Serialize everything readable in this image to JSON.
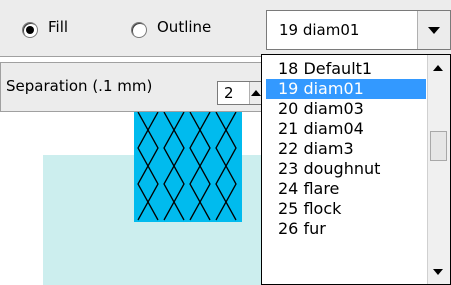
{
  "options": {
    "fill_label": "Fill",
    "outline_label": "Outline",
    "selected": "fill"
  },
  "pattern_select": {
    "value": "19 diam01"
  },
  "separation": {
    "label": "Separation (.1 mm)",
    "value": "2"
  },
  "dropdown": {
    "items": [
      "18 Default1",
      "19 diam01",
      "20 diam03",
      "21 diam04",
      "22 diam3",
      "23 doughnut",
      "24 flare",
      "25 flock",
      "26 fur"
    ],
    "selected_index": 1
  },
  "colors": {
    "pattern_fill": "#00bbee",
    "preview_background": "#cceeee",
    "selection": "#3399ff"
  },
  "icons": [
    "radio-checked-icon",
    "radio-unchecked-icon",
    "chevron-down-icon",
    "spin-up-icon",
    "scroll-up-icon",
    "scroll-down-icon"
  ]
}
